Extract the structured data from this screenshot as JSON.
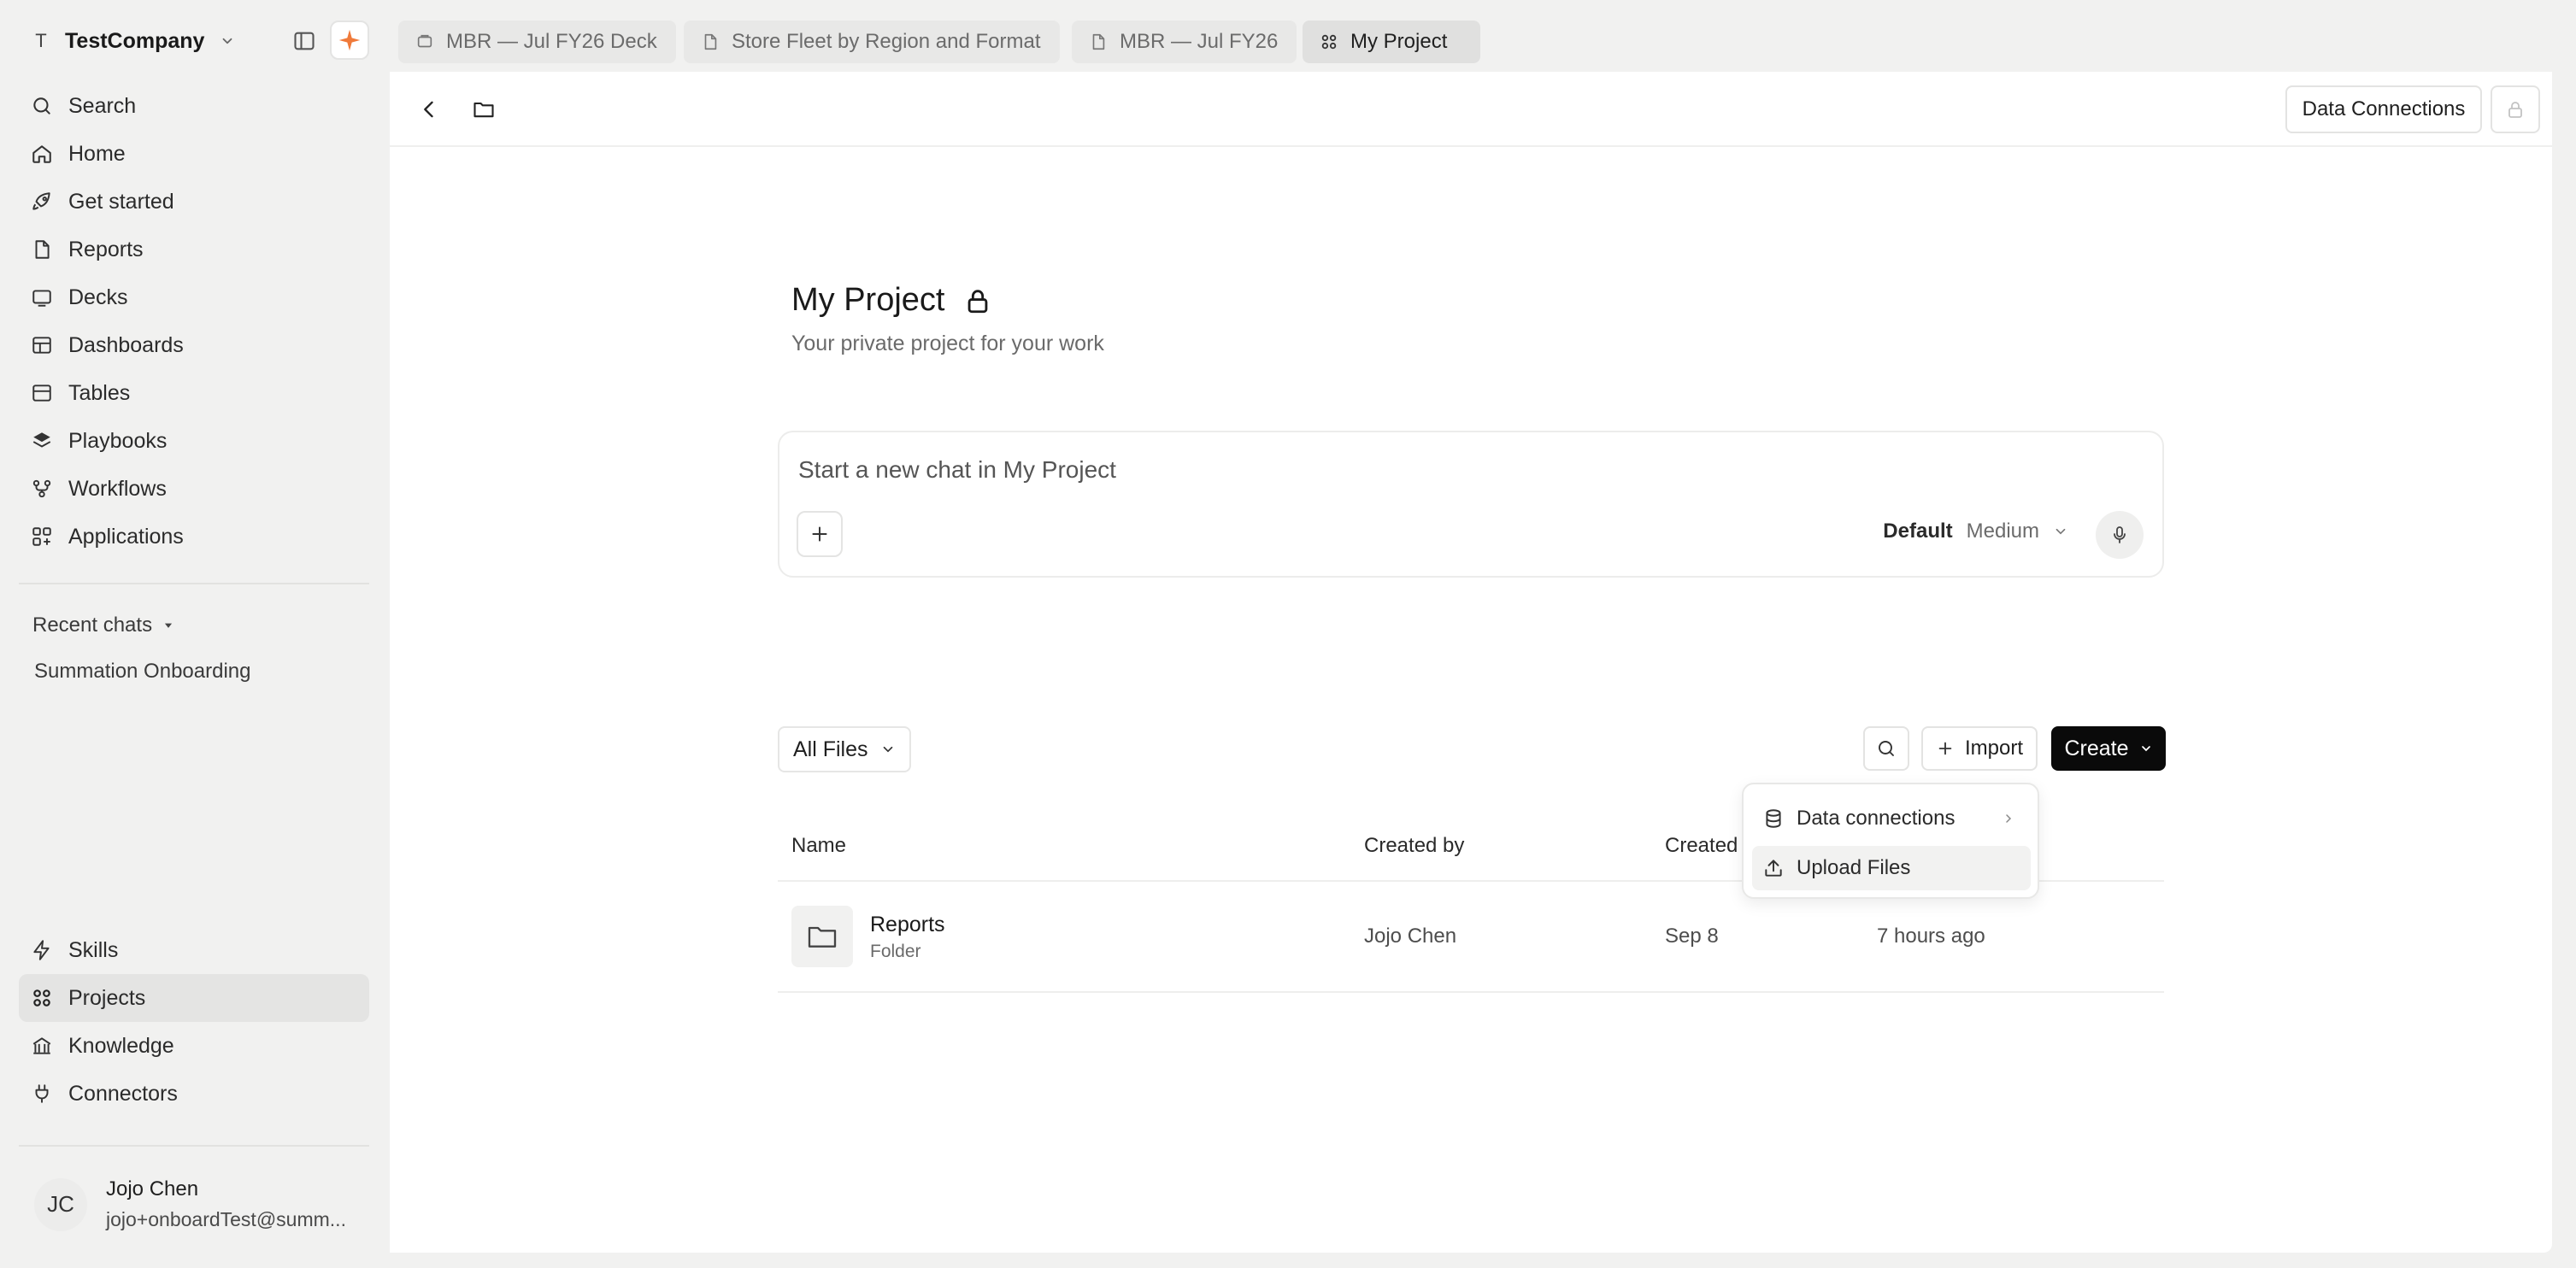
{
  "workspace": {
    "initial": "T",
    "name": "TestCompany"
  },
  "sidebar": {
    "nav": [
      {
        "label": "Search",
        "icon": "search-icon"
      },
      {
        "label": "Home",
        "icon": "home-icon"
      },
      {
        "label": "Get started",
        "icon": "rocket-icon"
      },
      {
        "label": "Reports",
        "icon": "document-icon"
      },
      {
        "label": "Decks",
        "icon": "deck-icon"
      },
      {
        "label": "Dashboards",
        "icon": "dashboard-icon"
      },
      {
        "label": "Tables",
        "icon": "table-icon"
      },
      {
        "label": "Playbooks",
        "icon": "layers-icon"
      },
      {
        "label": "Workflows",
        "icon": "workflow-icon"
      },
      {
        "label": "Applications",
        "icon": "apps-icon"
      }
    ],
    "recent_chats_label": "Recent chats",
    "recent_chats": [
      "Summation Onboarding"
    ],
    "bottom_nav": [
      {
        "label": "Skills",
        "icon": "bolt-icon"
      },
      {
        "label": "Projects",
        "icon": "grid-icon",
        "active": true
      },
      {
        "label": "Knowledge",
        "icon": "library-icon"
      },
      {
        "label": "Connectors",
        "icon": "plug-icon"
      }
    ],
    "user": {
      "initials": "JC",
      "name": "Jojo Chen",
      "email": "jojo+onboardTest@summ..."
    }
  },
  "tabs": [
    {
      "label": "MBR — Jul FY26 Deck",
      "icon": "deck-icon"
    },
    {
      "label": "Store Fleet by Region and Format",
      "icon": "document-icon"
    },
    {
      "label": "MBR — Jul FY26",
      "icon": "document-icon"
    },
    {
      "label": "My Project",
      "icon": "grid-icon",
      "active": true
    }
  ],
  "header": {
    "data_connections_label": "Data Connections"
  },
  "project": {
    "title": "My Project",
    "subtitle": "Your private project for your work"
  },
  "chat": {
    "placeholder": "Start a new chat in My Project",
    "model_label": "Default",
    "model_effort": "Medium"
  },
  "files": {
    "filter_label": "All Files",
    "import_label": "Import",
    "create_label": "Create",
    "columns": {
      "name": "Name",
      "created_by": "Created by",
      "created": "Created"
    },
    "rows": [
      {
        "name": "Reports",
        "type": "Folder",
        "created_by": "Jojo Chen",
        "created": "Sep 8",
        "updated": "7 hours ago"
      }
    ]
  },
  "create_menu": {
    "items": [
      {
        "label": "Data connections",
        "icon": "database-icon",
        "submenu": true
      },
      {
        "label": "Upload Files",
        "icon": "upload-icon",
        "hover": true
      }
    ]
  },
  "colors": {
    "accent": "#f07a3a",
    "create_button": "#0a0a0a",
    "sidebar_bg": "#f1f1f0",
    "active_item": "#e4e4e3"
  }
}
